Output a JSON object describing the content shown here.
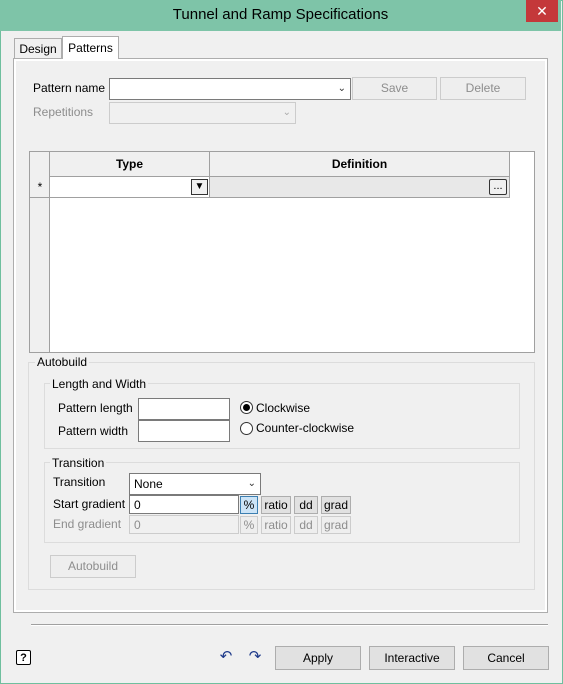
{
  "window": {
    "title": "Tunnel and Ramp Specifications",
    "close_glyph": "✕"
  },
  "tabs": [
    {
      "label": "Design"
    },
    {
      "label": "Patterns"
    }
  ],
  "pattern": {
    "name_label": "Pattern name",
    "name_value": "",
    "save_label": "Save",
    "delete_label": "Delete",
    "repetitions_label": "Repetitions",
    "repetitions_value": ""
  },
  "grid": {
    "columns": [
      "Type",
      "Definition"
    ],
    "new_row_marker": "*",
    "ellipsis": "...",
    "rows": []
  },
  "autobuild": {
    "group_label": "Autobuild",
    "length_width": {
      "group_label": "Length and Width",
      "pattern_length_label": "Pattern length",
      "pattern_length_value": "",
      "pattern_width_label": "Pattern width",
      "pattern_width_value": "",
      "clockwise_label": "Clockwise",
      "counter_clockwise_label": "Counter-clockwise",
      "selected_direction": "Clockwise"
    },
    "transition": {
      "group_label": "Transition",
      "transition_label": "Transition",
      "transition_value": "None",
      "start_gradient_label": "Start gradient",
      "start_gradient_value": "0",
      "end_gradient_label": "End gradient",
      "end_gradient_value": "0",
      "units": [
        "%",
        "ratio",
        "dd",
        "grad"
      ],
      "selected_unit": "%"
    },
    "button_label": "Autobuild"
  },
  "footer": {
    "help_glyph": "?",
    "undo_glyph": "↶",
    "redo_glyph": "↷",
    "apply_label": "Apply",
    "interactive_label": "Interactive",
    "cancel_label": "Cancel"
  }
}
